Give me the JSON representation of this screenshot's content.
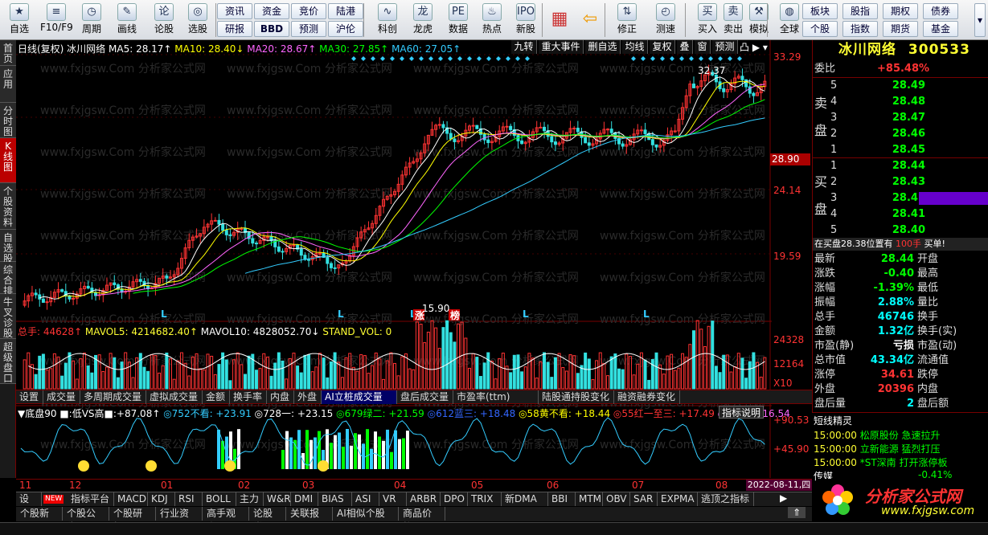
{
  "toolbar": {
    "items": [
      {
        "label": "自选",
        "icon": "star-icon"
      },
      {
        "label": "F10/F9",
        "icon": "info-icon"
      },
      {
        "label": "周期",
        "icon": "clock-icon"
      },
      {
        "label": "画线",
        "icon": "pen-icon"
      },
      {
        "label": "论股",
        "icon": "chat-icon"
      },
      {
        "label": "选股",
        "icon": "search-icon"
      },
      {
        "label": "科创",
        "icon": "chart-icon"
      },
      {
        "label": "龙虎",
        "icon": "dragon-icon"
      },
      {
        "label": "数据",
        "icon": "pe-icon"
      },
      {
        "label": "热点",
        "icon": "fire-icon"
      },
      {
        "label": "新股",
        "icon": "ipo-icon"
      },
      {
        "label": "修正",
        "icon": "arrows-icon"
      },
      {
        "label": "测速",
        "icon": "speedometer-icon"
      },
      {
        "label": "买入",
        "icon": "buy-icon"
      },
      {
        "label": "卖出",
        "icon": "sell-icon"
      },
      {
        "label": "模拟",
        "icon": "hammer-icon"
      },
      {
        "label": "全球",
        "icon": "globe-icon"
      }
    ],
    "mini_buttons": [
      "资讯",
      "资金",
      "竞价",
      "陆港",
      "研报",
      "BBD",
      "预测",
      "沪伦",
      "板块",
      "股指",
      "期权",
      "债券",
      "个股",
      "指数",
      "期货",
      "基金"
    ],
    "sun_icon_glyphs": [
      "买",
      "卖"
    ]
  },
  "side_tabs": [
    "首页",
    "应用",
    "分时图",
    "K线图",
    "个股资料",
    "自选股",
    "综合排名",
    "牛叉诊股",
    "超级盘口"
  ],
  "chart": {
    "header": "日线(复权)  冰川网络",
    "ma": [
      {
        "label": "MA5: 28.17↑",
        "color": "#ffffff"
      },
      {
        "label": "MA10: 28.40↓",
        "color": "#ffff00"
      },
      {
        "label": "MA20: 28.67↑",
        "color": "#ff66ff"
      },
      {
        "label": "MA30: 27.85↑",
        "color": "#00ff00"
      },
      {
        "label": "MA60: 27.05↑",
        "color": "#33ccff"
      }
    ],
    "menu": [
      "九转",
      "重大事件",
      "删自选",
      "均线",
      "复权",
      "叠",
      "窗",
      "预测"
    ],
    "price_axis": [
      "33.29",
      "28.90",
      "24.14",
      "19.59"
    ],
    "current_price": "28.90",
    "high_label": "32.37",
    "low_label": "15.90",
    "markers": [
      "L",
      "L",
      "L",
      "L",
      "L",
      "涨",
      "榜"
    ],
    "vol": {
      "total": "总手: 44628↑",
      "mavol5": "MAVOL5: 4214682.40↑",
      "mavol10": "MAVOL10: 4828052.70↓",
      "stand": "STAND_VOL: 0",
      "axis": [
        "24328",
        "12164",
        "X10"
      ]
    },
    "tabs1": [
      "设置",
      "成交量",
      "多周期成交量",
      "虚拟成交量",
      "金额",
      "换手率",
      "内盘",
      "外盘",
      "AI立桩成交量",
      "盘后成交量",
      "市盈率(ttm)",
      "陆股通持股变化",
      "融资融券变化"
    ],
    "tabs1_active": 8,
    "indicator": {
      "items": [
        {
          "t": "▼底盘90",
          "c": "#ffffff"
        },
        {
          "t": "■:低VS高■:+87.08↑",
          "c": "#ffffff"
        },
        {
          "t": "◎752不看: +23.91",
          "c": "#33ccff"
        },
        {
          "t": "◎728一: +23.15",
          "c": "#ffffff"
        },
        {
          "t": "◎679绿二: +21.59",
          "c": "#00ff00"
        },
        {
          "t": "◎612蓝三: +18.48",
          "c": "#3366ff"
        },
        {
          "t": "◎58黄不看: +18.44",
          "c": "#ffff00"
        },
        {
          "t": "◎55红一至三: +17.49",
          "c": "#ff3333"
        },
        {
          "t": "◎52一: +16.54",
          "c": "#ff66ff"
        }
      ],
      "help": "指标说明",
      "axis": [
        "+90.53",
        "+45.90"
      ]
    },
    "dates": [
      "11",
      "12",
      "01",
      "02",
      "03",
      "04",
      "05",
      "06",
      "07",
      "08"
    ],
    "date_badge": "2022-08-11,四"
  },
  "tabs2": {
    "settings": "设置",
    "new": "NEW",
    "items": [
      "指标平台",
      "MACD",
      "KDJ",
      "RSI",
      "BOLL",
      "主力",
      "W&R",
      "DMI",
      "BIAS",
      "ASI",
      "VR",
      "ARBR",
      "DPO",
      "TRIX",
      "新DMA",
      "BBI",
      "MTM",
      "OBV",
      "SAR",
      "EXPMA",
      "逃顶之指标"
    ]
  },
  "tabs3": [
    "个股新闻",
    "个股公告",
    "个股研报",
    "行业资讯",
    "高手观点",
    "论股堂",
    "关联报价",
    "AI相似个股",
    "商品价格"
  ],
  "quote": {
    "name": "冰川网络",
    "code": "300533",
    "weibi": {
      "label": "委比",
      "value": "+85.48%"
    },
    "sell": [
      {
        "lv": "5",
        "price": "28.49"
      },
      {
        "lv": "4",
        "price": "28.48"
      },
      {
        "lv": "3",
        "price": "28.47"
      },
      {
        "lv": "2",
        "price": "28.46"
      },
      {
        "lv": "1",
        "price": "28.45"
      }
    ],
    "buy": [
      {
        "lv": "1",
        "price": "28.44"
      },
      {
        "lv": "2",
        "price": "28.43"
      },
      {
        "lv": "3",
        "price": "28.42"
      },
      {
        "lv": "4",
        "price": "28.41"
      },
      {
        "lv": "5",
        "price": "28.40"
      }
    ],
    "sell_label": [
      "卖",
      "盘"
    ],
    "buy_label": [
      "买",
      "盘"
    ],
    "notice": {
      "text": "在买盘28.38位置有",
      "qty": "100手",
      "action": "买单!"
    },
    "stats": [
      {
        "l": "最新",
        "v": "28.44",
        "c": "grn",
        "r": "开盘"
      },
      {
        "l": "涨跌",
        "v": "-0.40",
        "c": "grn",
        "r": "最高"
      },
      {
        "l": "涨幅",
        "v": "-1.39%",
        "c": "grn",
        "r": "最低"
      },
      {
        "l": "振幅",
        "v": "2.88%",
        "c": "cyan",
        "r": "量比"
      },
      {
        "l": "总手",
        "v": "46746",
        "c": "cyan",
        "r": "换手"
      },
      {
        "l": "金额",
        "v": "1.32亿",
        "c": "cyan",
        "r": "换手(实)"
      },
      {
        "l": "市盈(静)",
        "v": "亏损",
        "c": "wht",
        "r": "市盈(动)"
      },
      {
        "l": "总市值",
        "v": "43.34亿",
        "c": "cyan",
        "r": "流通值"
      },
      {
        "l": "涨停",
        "v": "34.61",
        "c": "red",
        "r": "跌停"
      },
      {
        "l": "外盘",
        "v": "20396",
        "c": "red",
        "r": "内盘"
      },
      {
        "l": "盘后量",
        "v": "2",
        "c": "cyan",
        "r": "盘后额"
      }
    ],
    "sprite_title": "短线精灵",
    "sprite": [
      {
        "t": "15:00:00",
        "a": "松原股份",
        "b": "急速拉升"
      },
      {
        "t": "15:00:00",
        "a": "立新能源",
        "b": "猛烈打压"
      },
      {
        "t": "15:00:00",
        "a": "*ST深南",
        "b": "打开涨停板"
      }
    ],
    "sector": {
      "name": "传媒",
      "value": "-0.41%"
    }
  },
  "logo": {
    "text": "分析家公式网",
    "url": "www.fxjgsw.com"
  },
  "watermark": "www.fxjgsw.Com 分析家公式网"
}
